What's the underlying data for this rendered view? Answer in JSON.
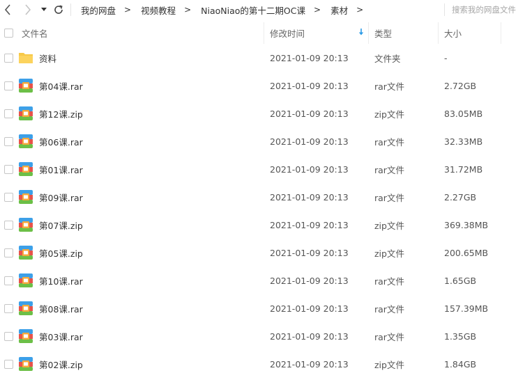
{
  "toolbar": {
    "back_icon": "chevron-left-icon",
    "forward_icon": "chevron-right-icon",
    "history_icon": "caret-down-icon",
    "refresh_icon": "refresh-icon"
  },
  "breadcrumb": [
    {
      "label": "我的网盘"
    },
    {
      "label": "视频教程"
    },
    {
      "label": "NiaoNiao的第十二期OC课"
    },
    {
      "label": "素材"
    }
  ],
  "breadcrumb_separator": ">",
  "search": {
    "placeholder": "搜索我的网盘文件"
  },
  "header": {
    "name": "文件名",
    "modified": "修改时间",
    "type": "类型",
    "size": "大小",
    "sort_icon": "sort-down-arrow-icon"
  },
  "colors": {
    "folder": "#f7c948",
    "sort_arrow": "#2b9ae6",
    "archive_red": "#e8534a",
    "archive_blue": "#3da0e8",
    "archive_green": "#6cbf47",
    "archive_orange": "#f4a93c"
  },
  "files": [
    {
      "name": "资料",
      "modified": "2021-01-09 20:13",
      "type": "文件夹",
      "size": "-",
      "icon": "folder-icon"
    },
    {
      "name": "第04课.rar",
      "modified": "2021-01-09 20:13",
      "type": "rar文件",
      "size": "2.72GB",
      "icon": "archive-icon"
    },
    {
      "name": "第12课.zip",
      "modified": "2021-01-09 20:13",
      "type": "zip文件",
      "size": "83.05MB",
      "icon": "archive-icon"
    },
    {
      "name": "第06课.rar",
      "modified": "2021-01-09 20:13",
      "type": "rar文件",
      "size": "32.33MB",
      "icon": "archive-icon"
    },
    {
      "name": "第01课.rar",
      "modified": "2021-01-09 20:13",
      "type": "rar文件",
      "size": "31.72MB",
      "icon": "archive-icon"
    },
    {
      "name": "第09课.rar",
      "modified": "2021-01-09 20:13",
      "type": "rar文件",
      "size": "2.27GB",
      "icon": "archive-icon"
    },
    {
      "name": "第07课.zip",
      "modified": "2021-01-09 20:13",
      "type": "zip文件",
      "size": "369.38MB",
      "icon": "archive-icon"
    },
    {
      "name": "第05课.zip",
      "modified": "2021-01-09 20:13",
      "type": "zip文件",
      "size": "200.65MB",
      "icon": "archive-icon"
    },
    {
      "name": "第10课.rar",
      "modified": "2021-01-09 20:13",
      "type": "rar文件",
      "size": "1.65GB",
      "icon": "archive-icon"
    },
    {
      "name": "第08课.rar",
      "modified": "2021-01-09 20:13",
      "type": "rar文件",
      "size": "157.39MB",
      "icon": "archive-icon"
    },
    {
      "name": "第03课.rar",
      "modified": "2021-01-09 20:13",
      "type": "rar文件",
      "size": "1.35GB",
      "icon": "archive-icon"
    },
    {
      "name": "第02课.zip",
      "modified": "2021-01-09 20:13",
      "type": "zip文件",
      "size": "1.84GB",
      "icon": "archive-icon"
    }
  ]
}
